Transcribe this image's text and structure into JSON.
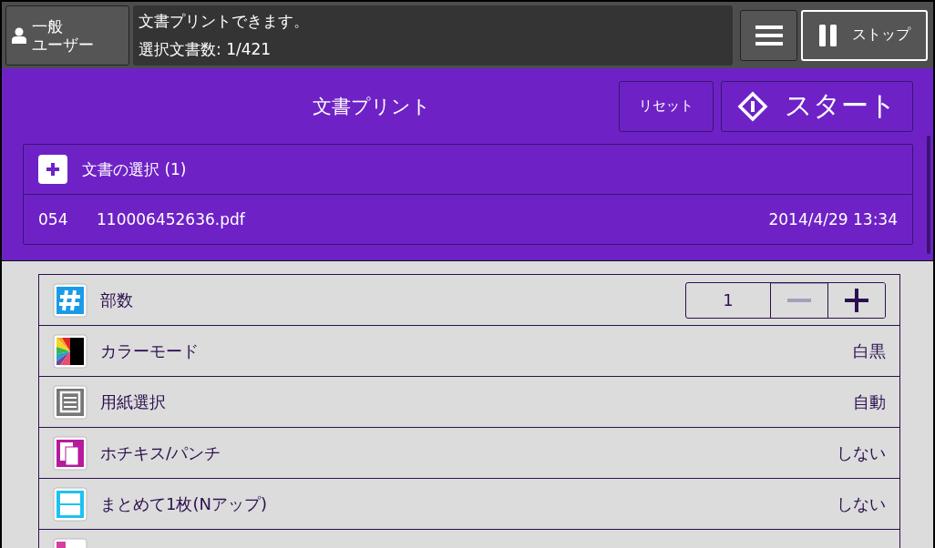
{
  "user_button": {
    "label_lines": [
      "一般",
      "ユーザー"
    ]
  },
  "status": {
    "message": "文書プリントできます。",
    "count": "選択文書数: 1/421"
  },
  "stop_button": {
    "label": "ストップ"
  },
  "title": "文書プリント",
  "reset_button": {
    "label": "リセット"
  },
  "start_button": {
    "label": "スタート"
  },
  "document_selection": {
    "label": "文書の選択 (1)",
    "documents": [
      {
        "number": "054",
        "name": "110006452636.pdf",
        "date": "2014/4/29  13:34"
      }
    ]
  },
  "settings": [
    {
      "kind": "stepper",
      "label": "部数",
      "value": "1",
      "minus_disabled": true
    },
    {
      "kind": "value",
      "label": "カラーモード",
      "value": "白黒"
    },
    {
      "kind": "value",
      "label": "用紙選択",
      "value": "自動"
    },
    {
      "kind": "value",
      "label": "ホチキス/パンチ",
      "value": "しない"
    },
    {
      "kind": "value",
      "label": "まとめて1枚(Nアップ)",
      "value": "しない"
    },
    {
      "kind": "partial"
    }
  ]
}
